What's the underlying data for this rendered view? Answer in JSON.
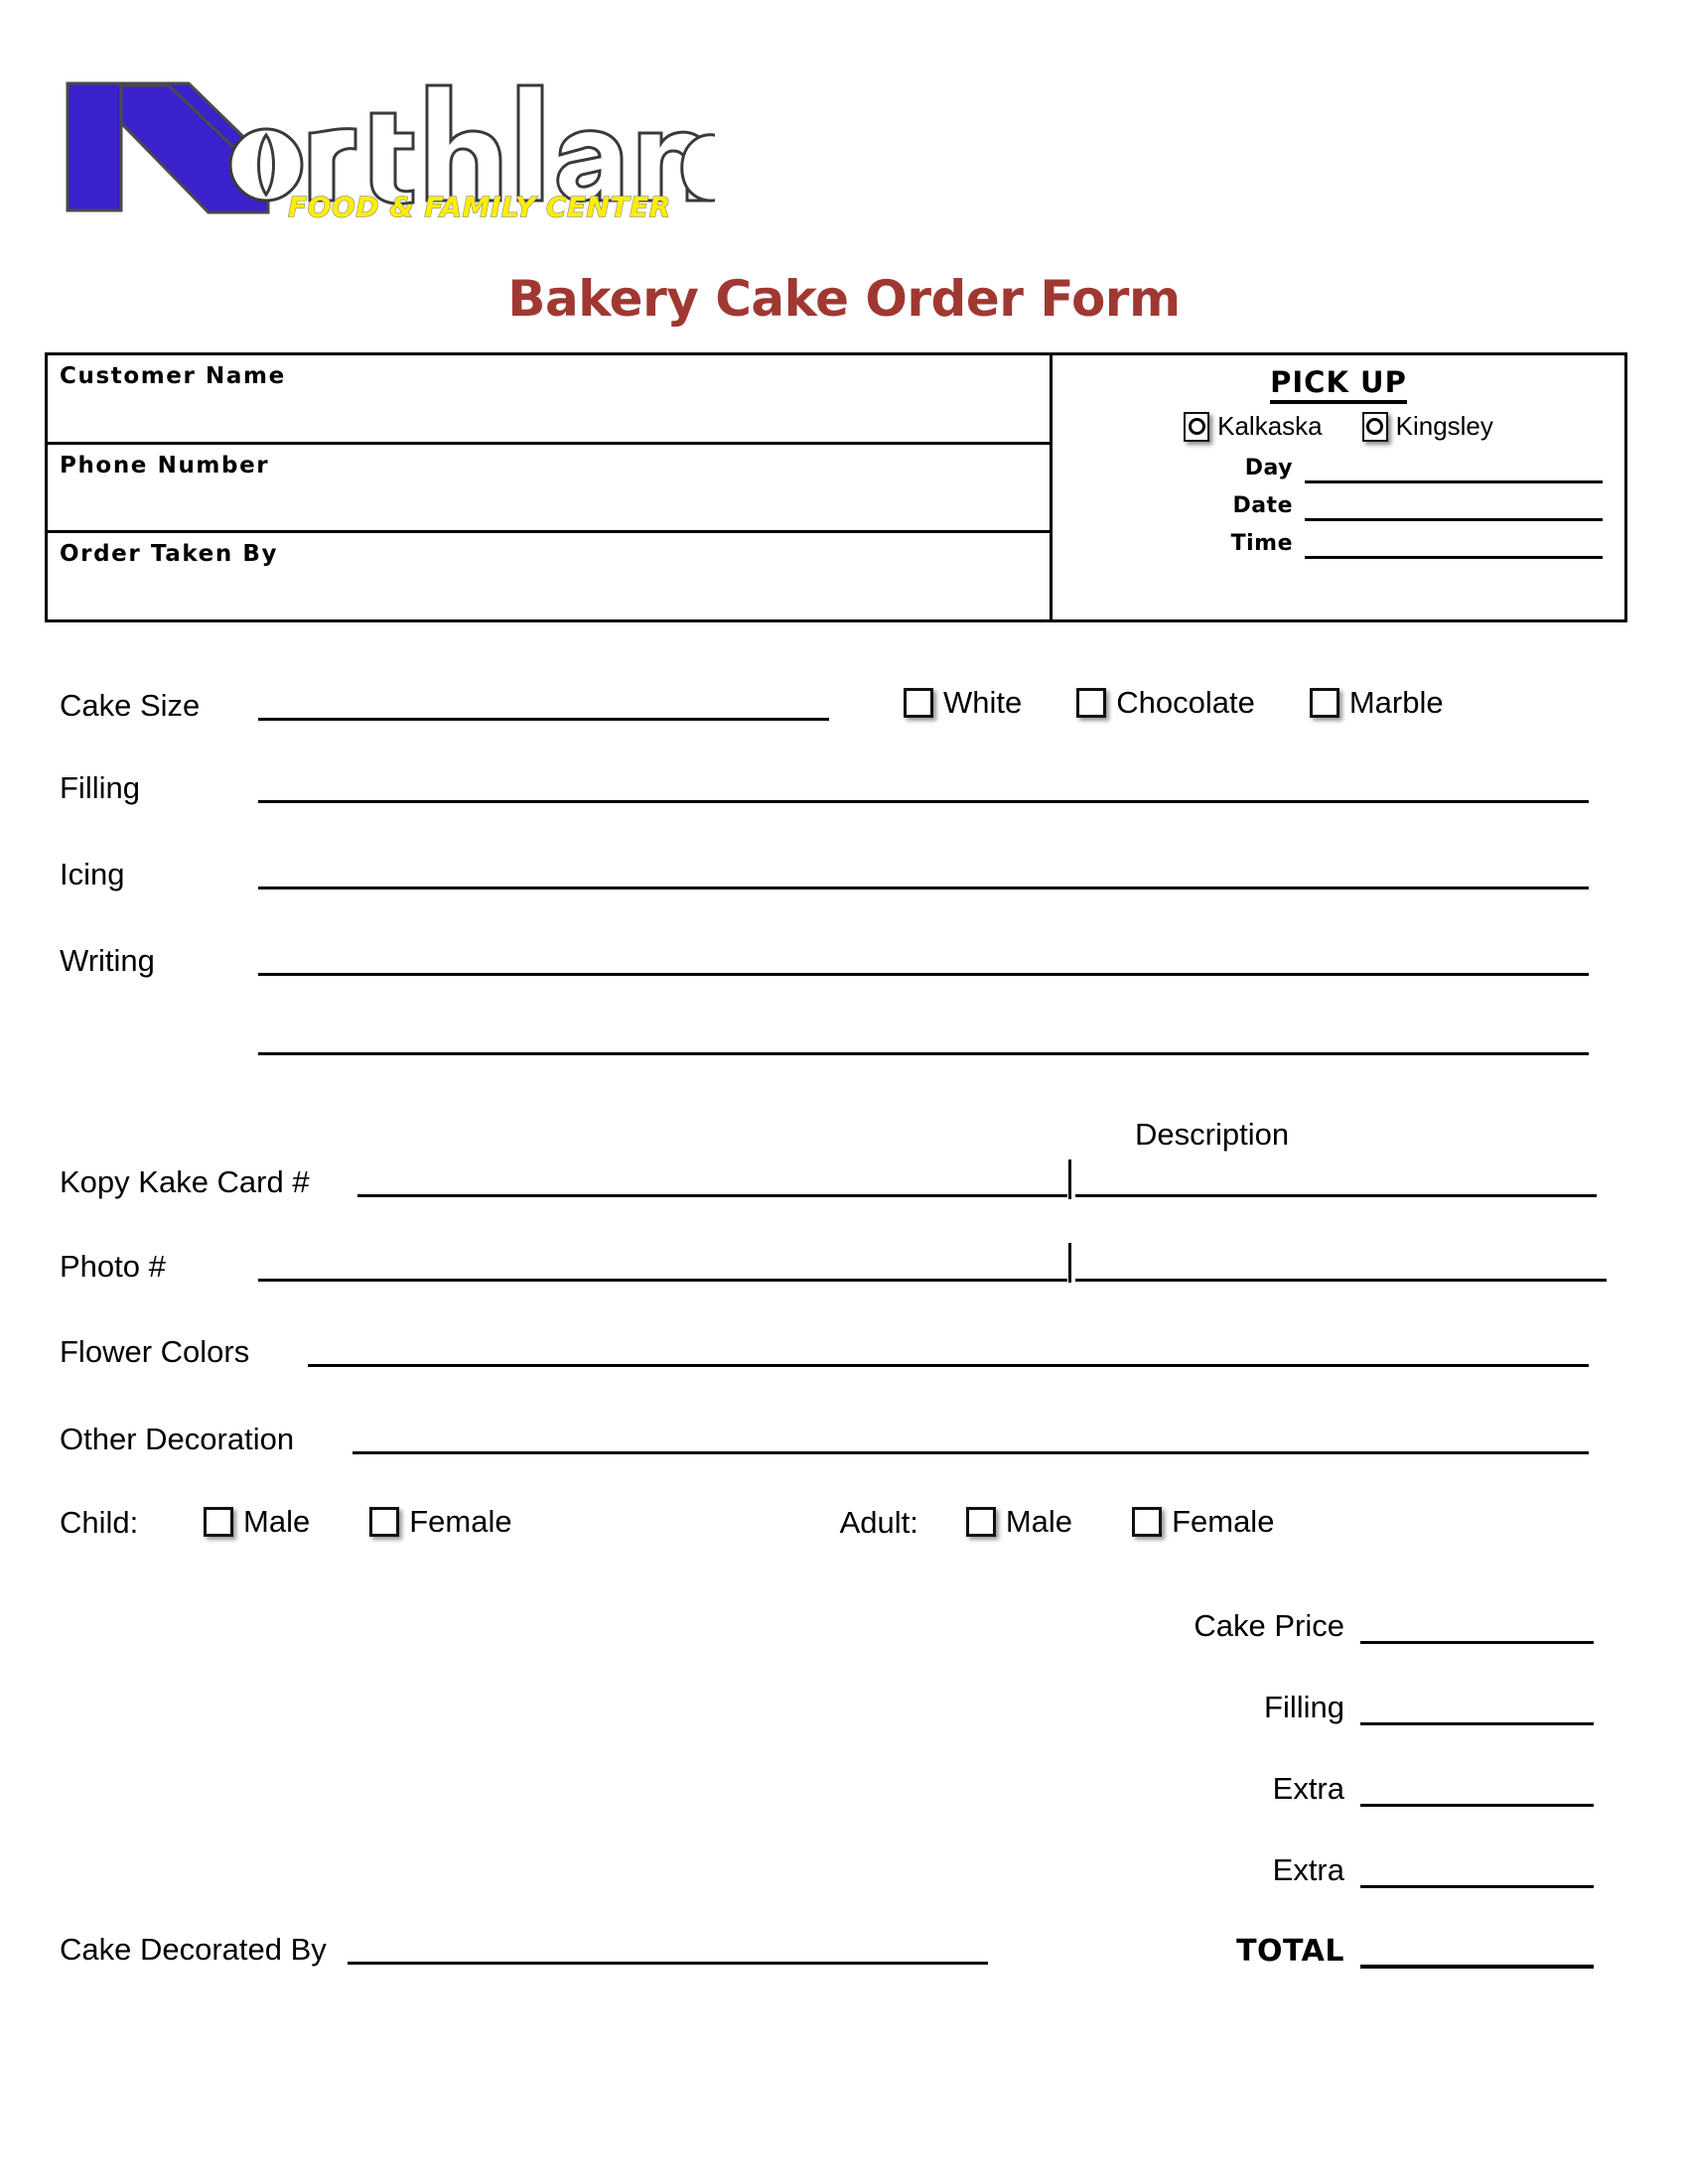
{
  "brand": {
    "name": "Northland",
    "tagline": "FOOD & FAMILY CENTER",
    "logo_blue": "#3A22CC",
    "tagline_yellow": "#FFEE00"
  },
  "title": "Bakery Cake Order Form",
  "title_color": "#A03832",
  "customer_box": {
    "fields": [
      {
        "label": "Customer Name",
        "value": ""
      },
      {
        "label": "Phone Number",
        "value": ""
      },
      {
        "label": "Order Taken By",
        "value": ""
      }
    ]
  },
  "pickup": {
    "heading": "PICK UP",
    "locations": [
      {
        "label": "Kalkaska",
        "selected": false
      },
      {
        "label": "Kingsley",
        "selected": false
      }
    ],
    "fields": [
      {
        "label": "Day",
        "value": ""
      },
      {
        "label": "Date",
        "value": ""
      },
      {
        "label": "Time",
        "value": ""
      }
    ]
  },
  "cake": {
    "size_label": "Cake Size",
    "size_value": "",
    "flavors": [
      {
        "label": "White",
        "checked": false
      },
      {
        "label": "Chocolate",
        "checked": false
      },
      {
        "label": "Marble",
        "checked": false
      }
    ],
    "filling_label": "Filling",
    "filling_value": "",
    "icing_label": "Icing",
    "icing_value": "",
    "writing_label": "Writing",
    "writing_value": "",
    "writing_value_2": ""
  },
  "design": {
    "description_heading": "Description",
    "kopy_kake_label": "Kopy Kake Card #",
    "kopy_kake_value": "",
    "kopy_kake_description": "",
    "photo_label": "Photo #",
    "photo_value": "",
    "photo_description": "",
    "flower_colors_label": "Flower Colors",
    "flower_colors_value": "",
    "other_decoration_label": "Other Decoration",
    "other_decoration_value": ""
  },
  "theme": {
    "child_label": "Child:",
    "child_options": [
      {
        "label": "Male",
        "checked": false
      },
      {
        "label": "Female",
        "checked": false
      }
    ],
    "adult_label": "Adult:",
    "adult_options": [
      {
        "label": "Male",
        "checked": false
      },
      {
        "label": "Female",
        "checked": false
      }
    ]
  },
  "pricing": {
    "rows": [
      {
        "label": "Cake Price",
        "value": ""
      },
      {
        "label": "Filling",
        "value": ""
      },
      {
        "label": "Extra",
        "value": ""
      },
      {
        "label": "Extra",
        "value": ""
      }
    ],
    "total_label": "TOTAL",
    "total_value": ""
  },
  "footer": {
    "decorated_by_label": "Cake Decorated By",
    "decorated_by_value": ""
  }
}
